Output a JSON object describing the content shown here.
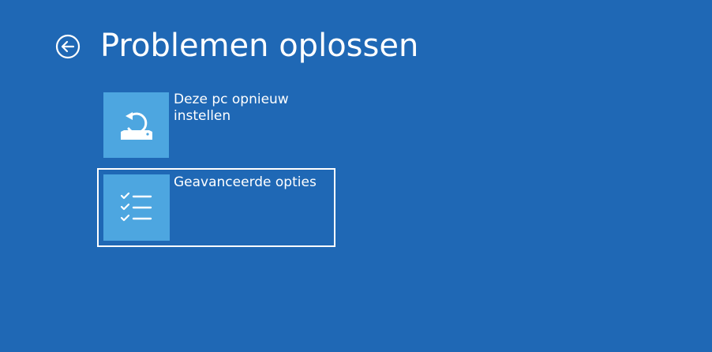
{
  "page": {
    "title": "Problemen oplossen",
    "background_color": "#1f68b5",
    "tile_color": "#4da6e0"
  },
  "back_button": {
    "icon": "back-arrow-icon"
  },
  "options": [
    {
      "label": "Deze pc opnieuw instellen",
      "icon": "reset-pc-icon",
      "selected": false
    },
    {
      "label": "Geavanceerde opties",
      "icon": "checklist-icon",
      "selected": true
    }
  ]
}
